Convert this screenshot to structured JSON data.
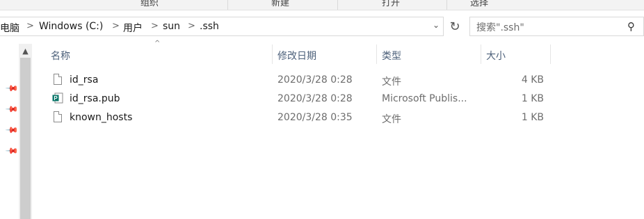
{
  "ribbon": {
    "groups": [
      "组织",
      "新建",
      "打开",
      "选择"
    ]
  },
  "address": {
    "crumbs": [
      "电脑",
      "Windows (C:)",
      "用户",
      "sun",
      ".ssh"
    ],
    "separator": ">"
  },
  "search": {
    "placeholder": "搜索\".ssh\""
  },
  "columns": {
    "name": "名称",
    "date": "修改日期",
    "type": "类型",
    "size": "大小"
  },
  "files": [
    {
      "name": "id_rsa",
      "date": "2020/3/28 0:28",
      "type": "文件",
      "size": "4 KB",
      "icon": "file-icon"
    },
    {
      "name": "id_rsa.pub",
      "date": "2020/3/28 0:28",
      "type": "Microsoft Publis...",
      "size": "1 KB",
      "icon": "publisher-icon"
    },
    {
      "name": "known_hosts",
      "date": "2020/3/28 0:35",
      "type": "文件",
      "size": "1 KB",
      "icon": "file-icon"
    }
  ],
  "icons": {
    "refresh": "refresh-icon",
    "search": "search-icon",
    "pin": "pin-icon",
    "sort": "sort-ascending-icon"
  },
  "colors": {
    "publisher_brand": "#077568",
    "header_text": "#4c607a",
    "secondary_text": "#6d6d6d"
  }
}
